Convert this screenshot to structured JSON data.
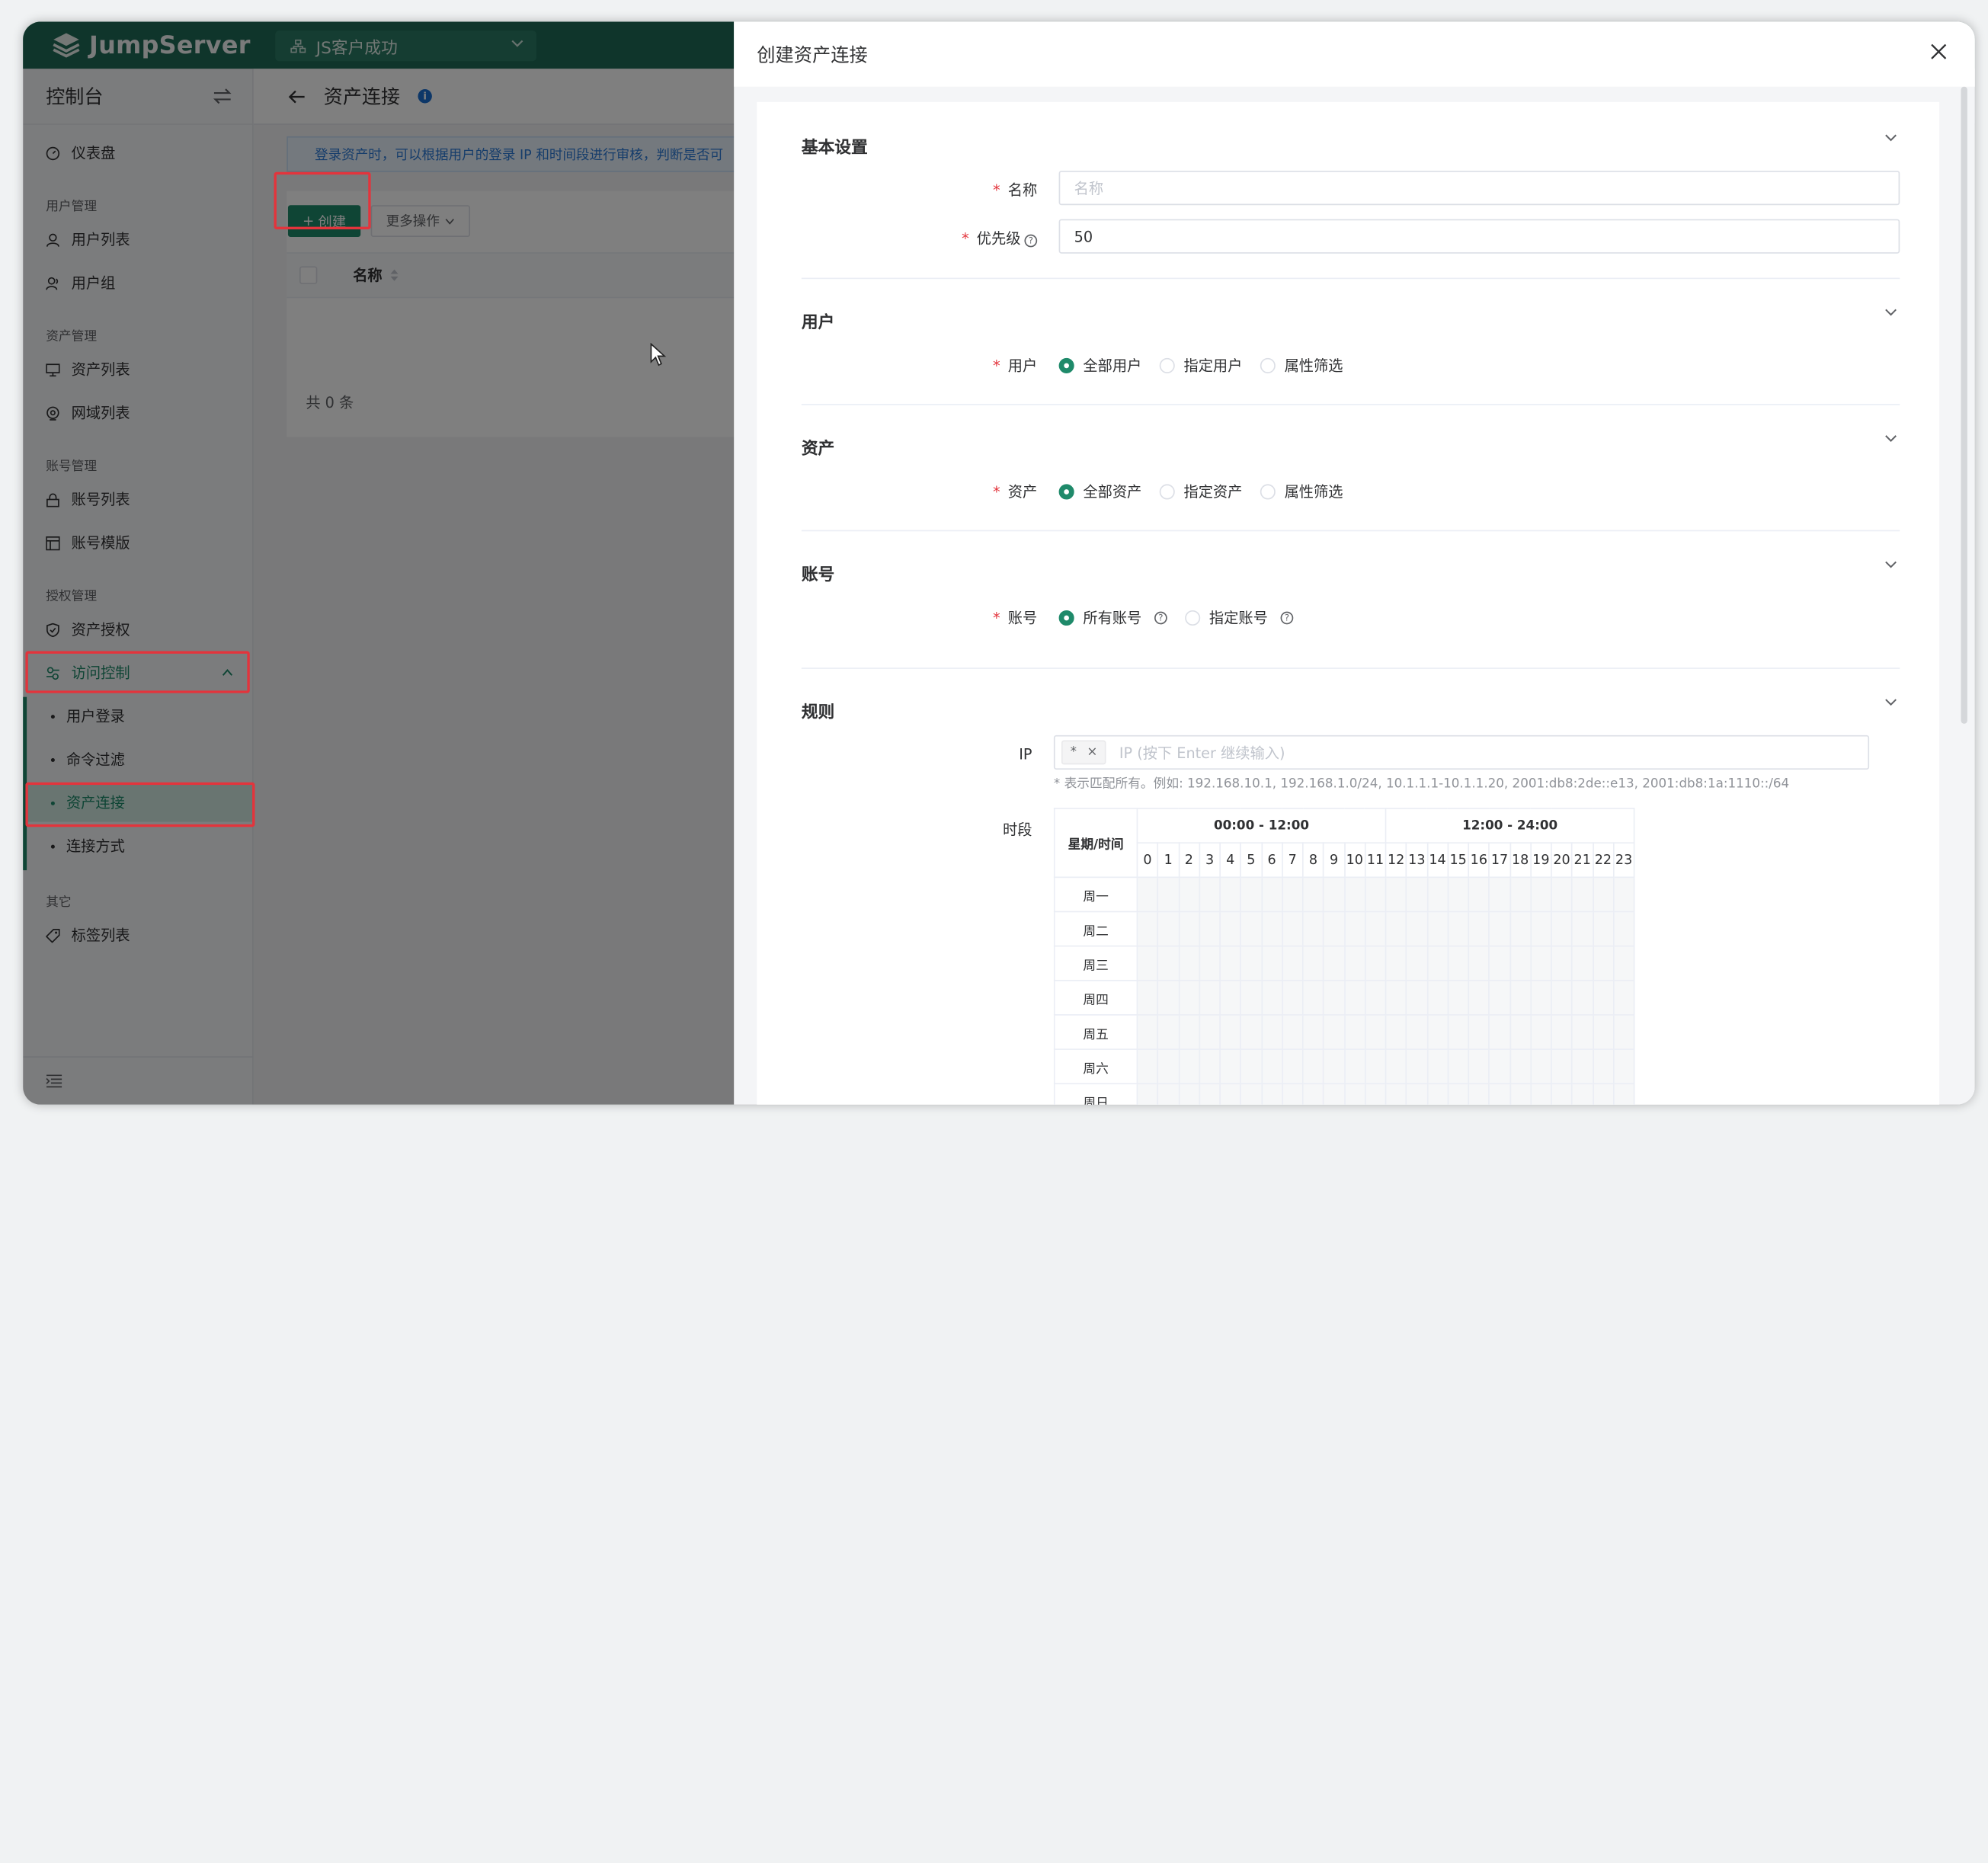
{
  "topbar": {
    "logo_text": "JumpServer",
    "org": "JS客户成功"
  },
  "sidebar": {
    "title": "控制台",
    "items": {
      "dashboard": "仪表盘",
      "group_user": "用户管理",
      "user_list": "用户列表",
      "user_group": "用户组",
      "group_asset": "资产管理",
      "asset_list": "资产列表",
      "zone_list": "网域列表",
      "group_account": "账号管理",
      "account_list": "账号列表",
      "account_template": "账号模版",
      "group_perm": "授权管理",
      "asset_perm": "资产授权",
      "access_control": "访问控制",
      "user_login": "用户登录",
      "cmd_filter": "命令过滤",
      "asset_connect": "资产连接",
      "connect_method": "连接方式",
      "group_other": "其它",
      "tag_list": "标签列表"
    }
  },
  "main": {
    "title": "资产连接",
    "notice": "登录资产时，可以根据用户的登录 IP 和时间段进行审核，判断是否可",
    "create_btn": "创建",
    "more_btn": "更多操作",
    "col_name": "名称",
    "total": "共 0 条"
  },
  "drawer": {
    "title": "创建资产连接",
    "basic": {
      "title": "基本设置",
      "name_label": "名称",
      "name_placeholder": "名称",
      "priority_label": "优先级",
      "priority_value": "50"
    },
    "user": {
      "title": "用户",
      "label": "用户",
      "opt1": "全部用户",
      "opt2": "指定用户",
      "opt3": "属性筛选"
    },
    "asset": {
      "title": "资产",
      "label": "资产",
      "opt1": "全部资产",
      "opt2": "指定资产",
      "opt3": "属性筛选"
    },
    "account": {
      "title": "账号",
      "label": "账号",
      "opt1": "所有账号",
      "opt2": "指定账号"
    },
    "rule": {
      "title": "规则",
      "ip_label": "IP",
      "ip_tag": "*",
      "ip_placeholder": "IP (按下 Enter 继续输入)",
      "ip_hint": "* 表示匹配所有。例如: 192.168.10.1, 192.168.1.0/24, 10.1.1.1-10.1.1.20, 2001:db8:2de::e13, 2001:db8:1a:1110::/64",
      "time_label": "时段",
      "week_time": "星期/时间",
      "range1": "00:00 - 12:00",
      "range2": "12:00 - 24:00",
      "hours": [
        "0",
        "1",
        "2",
        "3",
        "4",
        "5",
        "6",
        "7",
        "8",
        "9",
        "10",
        "11",
        "12",
        "13",
        "14",
        "15",
        "16",
        "17",
        "18",
        "19",
        "20",
        "21",
        "22",
        "23"
      ],
      "days": [
        "周一",
        "周二",
        "周三",
        "周四",
        "周五",
        "周六",
        "周日"
      ]
    }
  }
}
